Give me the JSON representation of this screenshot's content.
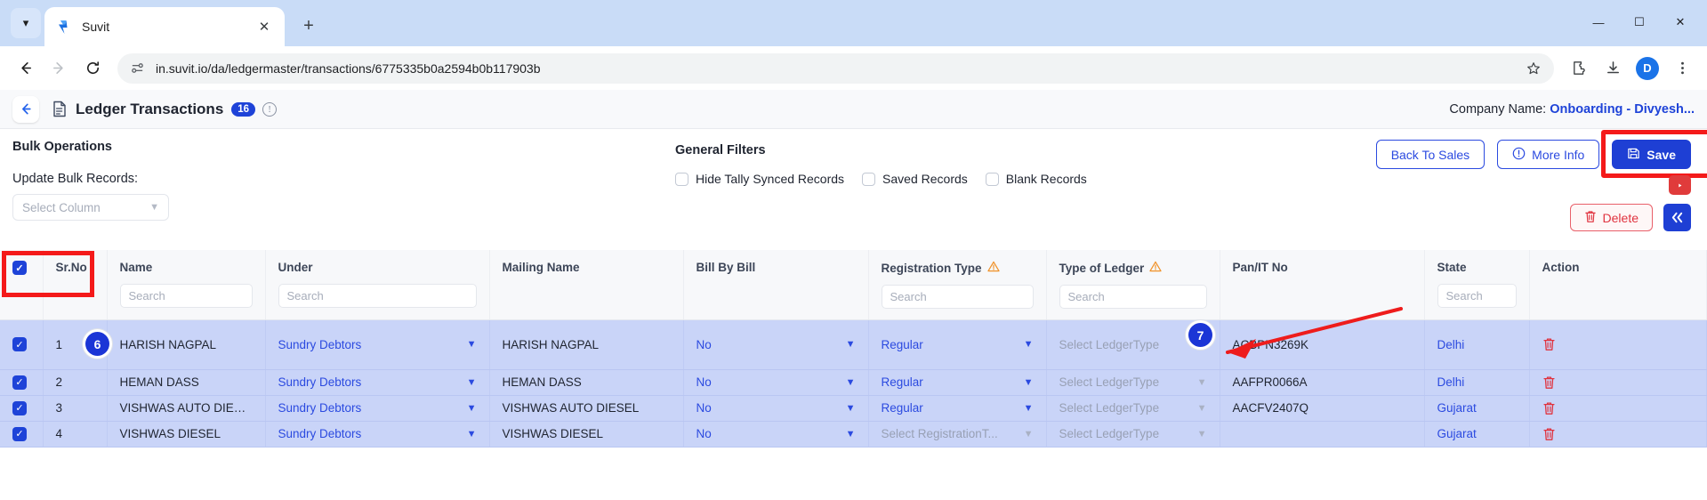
{
  "browser": {
    "tab": {
      "title": "Suvit",
      "favicon_icon": "suvit-logo-icon",
      "close_icon": "close-icon"
    },
    "tab_list_icon": "chevron-down-icon",
    "new_tab_icon": "plus-icon",
    "back_icon": "arrow-left-icon",
    "forward_icon": "arrow-right-icon",
    "reload_icon": "reload-icon",
    "site_info_icon": "site-settings-icon",
    "url": "in.suvit.io/da/ledgermaster/transactions/6775335b0a2594b0b117903b",
    "bookmark_icon": "star-icon",
    "extensions_icon": "puzzle-icon",
    "downloads_icon": "download-icon",
    "profile_initial": "D",
    "menu_icon": "kebab-menu-icon",
    "window": {
      "minimize": "—",
      "maximize": "❐",
      "close": "✕"
    }
  },
  "app_header": {
    "back_icon": "arrow-left-icon",
    "doc_icon": "document-icon",
    "title": "Ledger Transactions",
    "count": "16",
    "info_icon": "info-icon",
    "company_label": "Company Name:",
    "company_value": "Onboarding - Divyesh..."
  },
  "bulk": {
    "title": "Bulk Operations",
    "update_label": "Update Bulk Records:",
    "select_column_placeholder": "Select Column",
    "chevron_icon": "chevron-down-icon"
  },
  "filters": {
    "title": "General Filters",
    "items": [
      {
        "label": "Hide Tally Synced Records",
        "checked": false
      },
      {
        "label": "Saved Records",
        "checked": false
      },
      {
        "label": "Blank Records",
        "checked": false
      }
    ]
  },
  "actions": {
    "back_to_sales": "Back To Sales",
    "more_info": "More Info",
    "more_info_icon": "info-circle-icon",
    "save": "Save",
    "save_icon": "save-disk-icon",
    "youtube_icon": "play-icon",
    "delete": "Delete",
    "delete_icon": "trash-icon",
    "collapse_icon": "double-chevron-left-icon"
  },
  "annotations": {
    "step_six": "6",
    "step_seven": "7",
    "highlight_color": "#f41a1a",
    "arrow_color": "#ee1c1c"
  },
  "table": {
    "search_placeholder": "Search",
    "header_checkbox_checked": true,
    "columns": [
      {
        "key": "check",
        "label": "",
        "search": false,
        "warn": false
      },
      {
        "key": "srno",
        "label": "Sr.No",
        "search": false,
        "warn": false
      },
      {
        "key": "name",
        "label": "Name",
        "search": true,
        "warn": false
      },
      {
        "key": "under",
        "label": "Under",
        "search": true,
        "warn": false
      },
      {
        "key": "mailing",
        "label": "Mailing Name",
        "search": false,
        "warn": false
      },
      {
        "key": "billby",
        "label": "Bill By Bill",
        "search": false,
        "warn": false
      },
      {
        "key": "regtype",
        "label": "Registration Type",
        "search": true,
        "warn": true
      },
      {
        "key": "ledger",
        "label": "Type of Ledger",
        "search": true,
        "warn": true
      },
      {
        "key": "pan",
        "label": "Pan/IT No",
        "search": false,
        "warn": false
      },
      {
        "key": "state",
        "label": "State",
        "search": true,
        "warn": false
      },
      {
        "key": "action",
        "label": "Action",
        "search": false,
        "warn": false
      }
    ],
    "rows": [
      {
        "checked": true,
        "srno": "1",
        "name": "HARISH NAGPAL",
        "under": "Sundry Debtors",
        "under_muted": false,
        "mailing": "HARISH NAGPAL",
        "billby": "No",
        "billby_muted": false,
        "regtype": "Regular",
        "regtype_muted": false,
        "ledger": "Select LedgerType",
        "ledger_muted": true,
        "pan": "ACBPN3269K",
        "state": "Delhi"
      },
      {
        "checked": true,
        "srno": "2",
        "name": "HEMAN DASS",
        "under": "Sundry Debtors",
        "under_muted": false,
        "mailing": "HEMAN DASS",
        "billby": "No",
        "billby_muted": false,
        "regtype": "Regular",
        "regtype_muted": false,
        "ledger": "Select LedgerType",
        "ledger_muted": true,
        "pan": "AAFPR0066A",
        "state": "Delhi"
      },
      {
        "checked": true,
        "srno": "3",
        "name": "VISHWAS AUTO DIESEL",
        "under": "Sundry Debtors",
        "under_muted": false,
        "mailing": "VISHWAS AUTO DIESEL",
        "billby": "No",
        "billby_muted": false,
        "regtype": "Regular",
        "regtype_muted": false,
        "ledger": "Select LedgerType",
        "ledger_muted": true,
        "pan": "AACFV2407Q",
        "state": "Gujarat"
      },
      {
        "checked": true,
        "srno": "4",
        "name": "VISHWAS DIESEL",
        "under": "Sundry Debtors",
        "under_muted": false,
        "mailing": "VISHWAS DIESEL",
        "billby": "No",
        "billby_muted": false,
        "regtype": "Select RegistrationT...",
        "regtype_muted": true,
        "ledger": "Select LedgerType",
        "ledger_muted": true,
        "pan": "",
        "state": "Gujarat"
      }
    ]
  }
}
